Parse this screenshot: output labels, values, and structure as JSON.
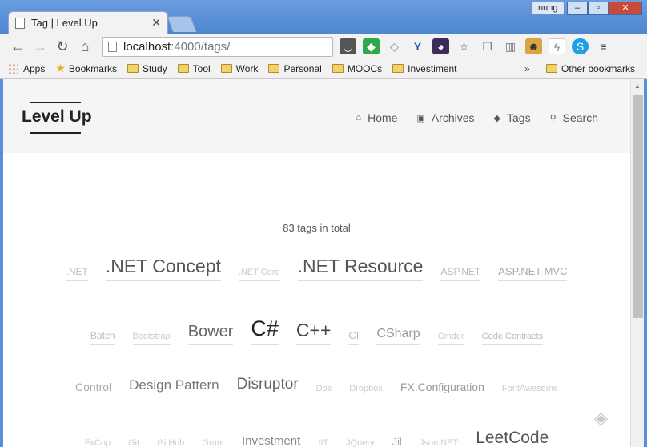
{
  "browser": {
    "tab_title": "Tag | Level Up",
    "tab_close": "✕",
    "user": "nung",
    "url_host": "localhost",
    "url_path": ":4000/tags/",
    "bookmarks": [
      "Apps",
      "Bookmarks",
      "Study",
      "Tool",
      "Work",
      "Personal",
      "MOOCs",
      "Investiment"
    ],
    "overflow": "»",
    "other_bookmarks": "Other bookmarks"
  },
  "site": {
    "brand": "Level Up",
    "nav": [
      {
        "label": "Home",
        "icon": "home-icon"
      },
      {
        "label": "Archives",
        "icon": "archive-icon"
      },
      {
        "label": "Tags",
        "icon": "tags-icon"
      },
      {
        "label": "Search",
        "icon": "search-icon"
      }
    ]
  },
  "tags_page": {
    "count_text": "83 tags in total",
    "rows": [
      [
        {
          "name": ".NET",
          "size": 12,
          "color": "#bbb"
        },
        {
          "name": ".NET Concept",
          "size": 23,
          "color": "#555"
        },
        {
          "name": ".NET Core",
          "size": 11,
          "color": "#ccc"
        },
        {
          "name": ".NET Resource",
          "size": 23,
          "color": "#555"
        },
        {
          "name": "ASP.NET",
          "size": 12,
          "color": "#bbb"
        },
        {
          "name": "ASP.NET MVC",
          "size": 13,
          "color": "#aaa"
        }
      ],
      [
        {
          "name": "Batch",
          "size": 12,
          "color": "#bbb"
        },
        {
          "name": "Bootstrap",
          "size": 11,
          "color": "#ccc"
        },
        {
          "name": "Bower",
          "size": 20,
          "color": "#666"
        },
        {
          "name": "C#",
          "size": 27,
          "color": "#222"
        },
        {
          "name": "C++",
          "size": 23,
          "color": "#444"
        },
        {
          "name": "CI",
          "size": 13,
          "color": "#bbb"
        },
        {
          "name": "CSharp",
          "size": 16,
          "color": "#999"
        },
        {
          "name": "Cmder",
          "size": 11,
          "color": "#ccc"
        },
        {
          "name": "Code Contracts",
          "size": 11,
          "color": "#bbb"
        }
      ],
      [
        {
          "name": "Control",
          "size": 14,
          "color": "#aaa"
        },
        {
          "name": "Design Pattern",
          "size": 17,
          "color": "#777"
        },
        {
          "name": "Disruptor",
          "size": 19,
          "color": "#666"
        },
        {
          "name": "Dos",
          "size": 11,
          "color": "#ccc"
        },
        {
          "name": "Dropbox",
          "size": 11,
          "color": "#ccc"
        },
        {
          "name": "FX.Configuration",
          "size": 14,
          "color": "#999"
        },
        {
          "name": "FontAwesome",
          "size": 11,
          "color": "#ccc"
        }
      ],
      [
        {
          "name": "FxCop",
          "size": 11,
          "color": "#ccc"
        },
        {
          "name": "Git",
          "size": 11,
          "color": "#ccc"
        },
        {
          "name": "GitHub",
          "size": 11,
          "color": "#ccc"
        },
        {
          "name": "Grunt",
          "size": 11,
          "color": "#ccc"
        },
        {
          "name": "Investment",
          "size": 15,
          "color": "#888"
        },
        {
          "name": "IIT",
          "size": 11,
          "color": "#ccc"
        },
        {
          "name": "JQuery",
          "size": 11,
          "color": "#ccc"
        },
        {
          "name": "Jil",
          "size": 13,
          "color": "#aaa"
        },
        {
          "name": "Json.NET",
          "size": 11,
          "color": "#ccc"
        },
        {
          "name": "LeetCode",
          "size": 21,
          "color": "#555"
        }
      ]
    ]
  }
}
